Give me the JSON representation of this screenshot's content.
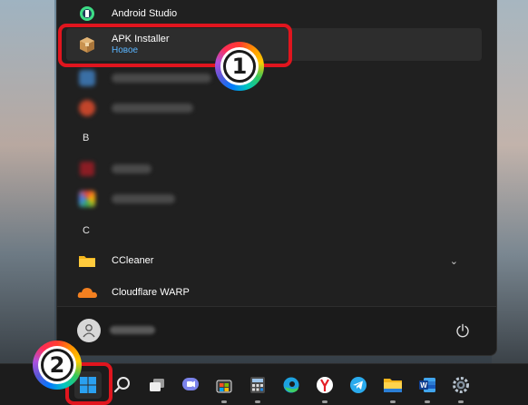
{
  "start_menu": {
    "apps": [
      {
        "name": "Android Studio",
        "icon": "android-studio-icon"
      },
      {
        "name": "APK Installer",
        "subtitle": "Новое",
        "icon": "package-box-icon",
        "selected": true
      },
      {
        "name": "",
        "icon": "blurred-app-icon",
        "blurred": true
      },
      {
        "name": "",
        "icon": "blurred-app-icon",
        "blurred": true
      },
      {
        "name": "",
        "icon": "blurred-app-icon",
        "blurred": true
      },
      {
        "name": "",
        "icon": "blurred-app-icon",
        "blurred": true
      },
      {
        "name": "CCleaner",
        "icon": "folder-icon"
      },
      {
        "name": "Cloudflare WARP",
        "icon": "cloudflare-icon"
      }
    ],
    "section_headers": [
      "B",
      "C"
    ],
    "user": {
      "name": ""
    },
    "power_icon": "power-icon"
  },
  "annotations": {
    "badge_1": "1",
    "badge_2": "2",
    "highlight_color": "#e0151e"
  },
  "taskbar": {
    "icons": [
      "start-button",
      "search-icon",
      "task-view-icon",
      "teams-chat-icon",
      "store-icon",
      "calculator-icon",
      "edge-icon",
      "yandex-icon",
      "telegram-icon",
      "file-explorer-icon",
      "word-icon",
      "settings-icon"
    ]
  }
}
